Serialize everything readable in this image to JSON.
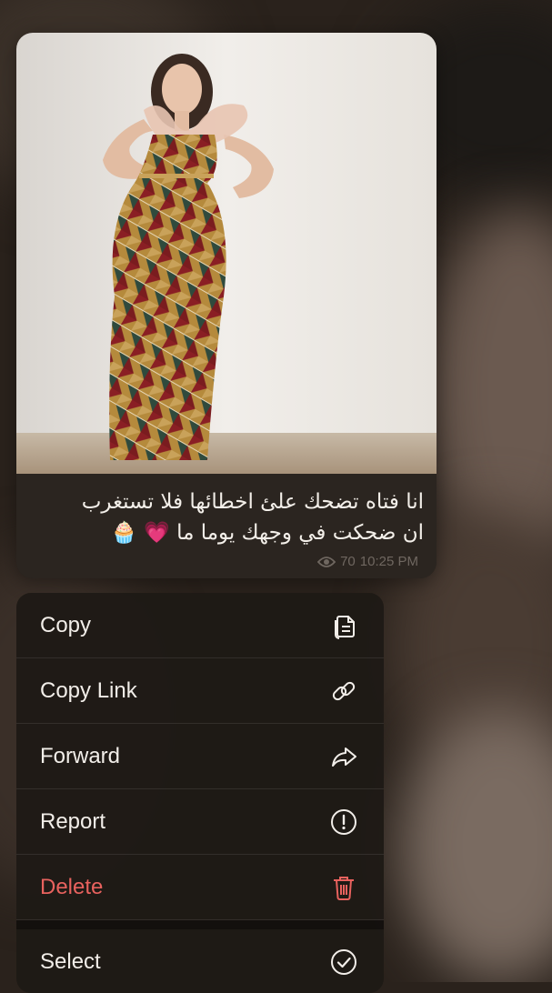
{
  "message": {
    "caption_line1": "انا فتاه تضحك علئ اخطائها فلا تستغرب",
    "caption_line2": "ان ضحكت في وجهك يوما ما 💗 🧁",
    "views": "70",
    "time": "10:25 PM",
    "views_icon": "eye-icon"
  },
  "menu": {
    "items": [
      {
        "label": "Copy",
        "icon": "copy-icon"
      },
      {
        "label": "Copy Link",
        "icon": "link-icon"
      },
      {
        "label": "Forward",
        "icon": "forward-icon"
      },
      {
        "label": "Report",
        "icon": "report-icon"
      },
      {
        "label": "Delete",
        "icon": "trash-icon"
      },
      {
        "label": "Select",
        "icon": "check-circle-icon"
      }
    ]
  },
  "colors": {
    "danger": "#e8625e",
    "menu_text": "#f2eee9",
    "caption_bg": "#2b2520"
  }
}
